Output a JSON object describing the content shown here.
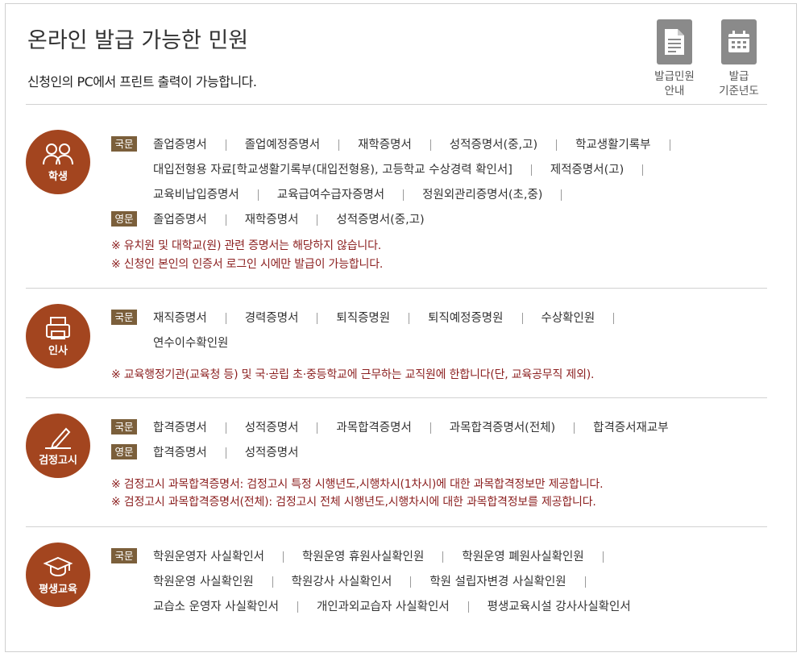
{
  "header": {
    "title": "온라인 발급 가능한 민원",
    "subtitle": "신청인의 PC에서 프린트 출력이 가능합니다.",
    "buttons": [
      {
        "label": "발급민원\n안내",
        "icon": "document-icon"
      },
      {
        "label": "발급\n기준년도",
        "icon": "calendar-icon"
      }
    ]
  },
  "sections": [
    {
      "name": "학생",
      "icon": "students-icon",
      "rows": [
        {
          "tag": "국문",
          "lines": [
            [
              "졸업증명서",
              "졸업예정증명서",
              "재학증명서",
              "성적증명서(중,고)",
              "학교생활기록부"
            ],
            [
              "대입전형용 자료[학교생활기록부(대입전형용), 고등학교 수상경력 확인서]",
              "제적증명서(고)"
            ],
            [
              "교육비납입증명서",
              "교육급여수급자증명서",
              "정원외관리증명서(초,중)"
            ]
          ]
        },
        {
          "tag": "영문",
          "lines": [
            [
              "졸업증명서",
              "재학증명서",
              "성적증명서(중,고)"
            ]
          ]
        }
      ],
      "notes": [
        "※ 유치원 및 대학교(원) 관련 증명서는 해당하지 않습니다.",
        "※ 신청인 본인의 인증서 로그인 시에만 발급이 가능합니다."
      ]
    },
    {
      "name": "인사",
      "icon": "printer-icon",
      "rows": [
        {
          "tag": "국문",
          "lines": [
            [
              "재직증명서",
              "경력증명서",
              "퇴직증명원",
              "퇴직예정증명원",
              "수상확인원"
            ],
            [
              "연수이수확인원"
            ]
          ]
        }
      ],
      "notes": [
        "※ 교육행정기관(교육청 등) 및 국·공립 초·중등학교에 근무하는 교직원에 한합니다(단, 교육공무직 제외)."
      ]
    },
    {
      "name": "검정고시",
      "icon": "pencil-icon",
      "rows": [
        {
          "tag": "국문",
          "lines": [
            [
              "합격증명서",
              "성적증명서",
              "과목합격증명서",
              "과목합격증명서(전체)",
              "합격증서재교부"
            ]
          ]
        },
        {
          "tag": "영문",
          "lines": [
            [
              "합격증명서",
              "성적증명서"
            ]
          ]
        }
      ],
      "notes": [
        "※ 검정고시 과목합격증명서: 검정고시 특정 시행년도,시행차시(1차시)에 대한 과목합격정보만 제공합니다.",
        "※ 검정고시 과목합격증명서(전체): 검정고시 전체 시행년도,시행차시에 대한 과목합격정보를 제공합니다."
      ]
    },
    {
      "name": "평생교육",
      "icon": "graduation-cap-icon",
      "rows": [
        {
          "tag": "국문",
          "lines": [
            [
              "학원운영자 사실확인서",
              "학원운영 휴원사실확인원",
              "학원운영 폐원사실확인원"
            ],
            [
              "학원운영 사실확인원",
              "학원강사 사실확인서",
              "학원 설립자변경 사실확인원"
            ],
            [
              "교습소 운영자 사실확인서",
              "개인과외교습자 사실확인서",
              "평생교육시설 강사사실확인서"
            ]
          ]
        }
      ],
      "notes": []
    }
  ],
  "colors": {
    "accent": "#a3451f",
    "tag": "#7b5f3b",
    "note": "#8b1f1f",
    "divider": "#d2d2d2"
  }
}
